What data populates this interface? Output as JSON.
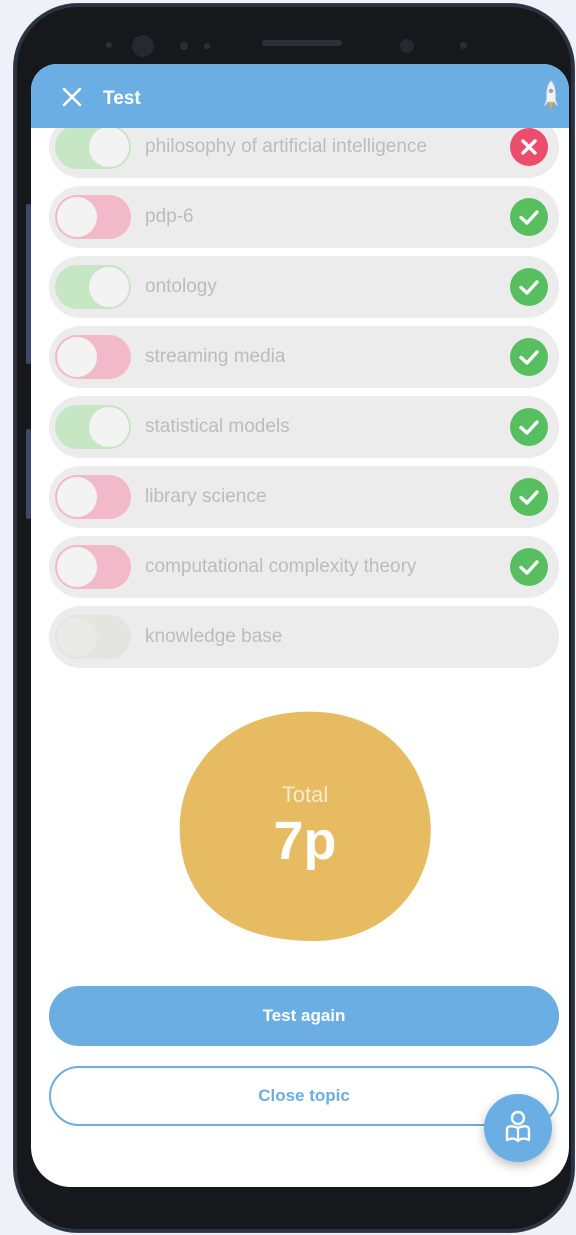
{
  "header": {
    "title": "Test",
    "close_icon": "close-icon",
    "right_icon": "rocket-icon",
    "color": "#6aaee3"
  },
  "topics": [
    {
      "label": "philosophy of artificial intelligence",
      "toggle": "green",
      "status": "wrong"
    },
    {
      "label": "pdp-6",
      "toggle": "pink",
      "status": "correct"
    },
    {
      "label": "ontology",
      "toggle": "green",
      "status": "correct"
    },
    {
      "label": "streaming media",
      "toggle": "pink",
      "status": "correct"
    },
    {
      "label": "statistical models",
      "toggle": "green",
      "status": "correct"
    },
    {
      "label": "library science",
      "toggle": "pink",
      "status": "correct"
    },
    {
      "label": "computational complexity theory",
      "toggle": "pink",
      "status": "correct"
    },
    {
      "label": "knowledge base",
      "toggle": "none",
      "status": "none"
    }
  ],
  "score": {
    "label": "Total",
    "value": "7p",
    "color": "#e6bb62"
  },
  "buttons": {
    "test_again": "Test again",
    "close_topic": "Close topic"
  },
  "fab": {
    "icon": "reader-icon"
  },
  "colors": {
    "correct": "#58bf60",
    "wrong": "#ec4d6d",
    "toggle_green": "#c7e6c4",
    "toggle_pink": "#f2b9ca"
  }
}
